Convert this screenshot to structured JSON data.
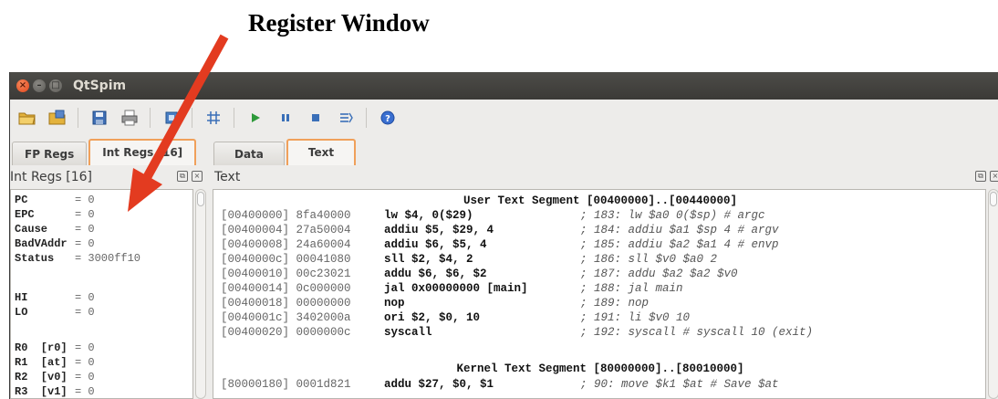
{
  "annotation": {
    "title": "Register Window",
    "arrow_color": "#e33b20"
  },
  "window": {
    "title": "QtSpim"
  },
  "toolbar": {
    "icons": [
      "open-folder-icon",
      "reload-icon",
      "save-icon",
      "print-icon",
      "clear-icon",
      "grid-icon",
      "run-icon",
      "pause-icon",
      "stop-icon",
      "step-icon",
      "help-icon"
    ]
  },
  "tabs_left": [
    {
      "label": "FP Regs",
      "active": false
    },
    {
      "label": "Int Regs [16]",
      "active": true
    }
  ],
  "tabs_right": [
    {
      "label": "Data",
      "active": false
    },
    {
      "label": "Text",
      "active": true
    }
  ],
  "reg_panel": {
    "title": "Int Regs [16]"
  },
  "text_panel": {
    "title": "Text"
  },
  "registers_top": [
    {
      "name": "PC",
      "value": "= 0"
    },
    {
      "name": "EPC",
      "value": "= 0"
    },
    {
      "name": "Cause",
      "value": "= 0"
    },
    {
      "name": "BadVAddr",
      "value": "= 0"
    },
    {
      "name": "Status",
      "value": "= 3000ff10"
    }
  ],
  "registers_hilo": [
    {
      "name": "HI",
      "value": "= 0"
    },
    {
      "name": "LO",
      "value": "= 0"
    }
  ],
  "registers_gp": [
    {
      "name": "R0  [r0]",
      "value": "= 0"
    },
    {
      "name": "R1  [at]",
      "value": "= 0"
    },
    {
      "name": "R2  [v0]",
      "value": "= 0"
    },
    {
      "name": "R3  [v1]",
      "value": "= 0"
    }
  ],
  "user_segment": "User Text Segment [00400000]..[00440000]",
  "user_lines": [
    {
      "addr": "[00400000] 8fa40000",
      "ins": "lw $4, 0($29)",
      "cmt": "; 183: lw $a0 0($sp) # argc"
    },
    {
      "addr": "[00400004] 27a50004",
      "ins": "addiu $5, $29, 4",
      "cmt": "; 184: addiu $a1 $sp 4 # argv"
    },
    {
      "addr": "[00400008] 24a60004",
      "ins": "addiu $6, $5, 4",
      "cmt": "; 185: addiu $a2 $a1 4 # envp"
    },
    {
      "addr": "[0040000c] 00041080",
      "ins": "sll $2, $4, 2",
      "cmt": "; 186: sll $v0 $a0 2"
    },
    {
      "addr": "[00400010] 00c23021",
      "ins": "addu $6, $6, $2",
      "cmt": "; 187: addu $a2 $a2 $v0"
    },
    {
      "addr": "[00400014] 0c000000",
      "ins": "jal 0x00000000 [main]",
      "cmt": "; 188: jal main"
    },
    {
      "addr": "[00400018] 00000000",
      "ins": "nop",
      "cmt": "; 189: nop"
    },
    {
      "addr": "[0040001c] 3402000a",
      "ins": "ori $2, $0, 10",
      "cmt": "; 191: li $v0 10"
    },
    {
      "addr": "[00400020] 0000000c",
      "ins": "syscall",
      "cmt": "; 192: syscall # syscall 10 (exit)"
    }
  ],
  "kernel_segment": "Kernel Text Segment [80000000]..[80010000]",
  "kernel_lines": [
    {
      "addr": "[80000180] 0001d821",
      "ins": "addu $27, $0, $1",
      "cmt": "; 90: move $k1 $at # Save $at"
    }
  ]
}
